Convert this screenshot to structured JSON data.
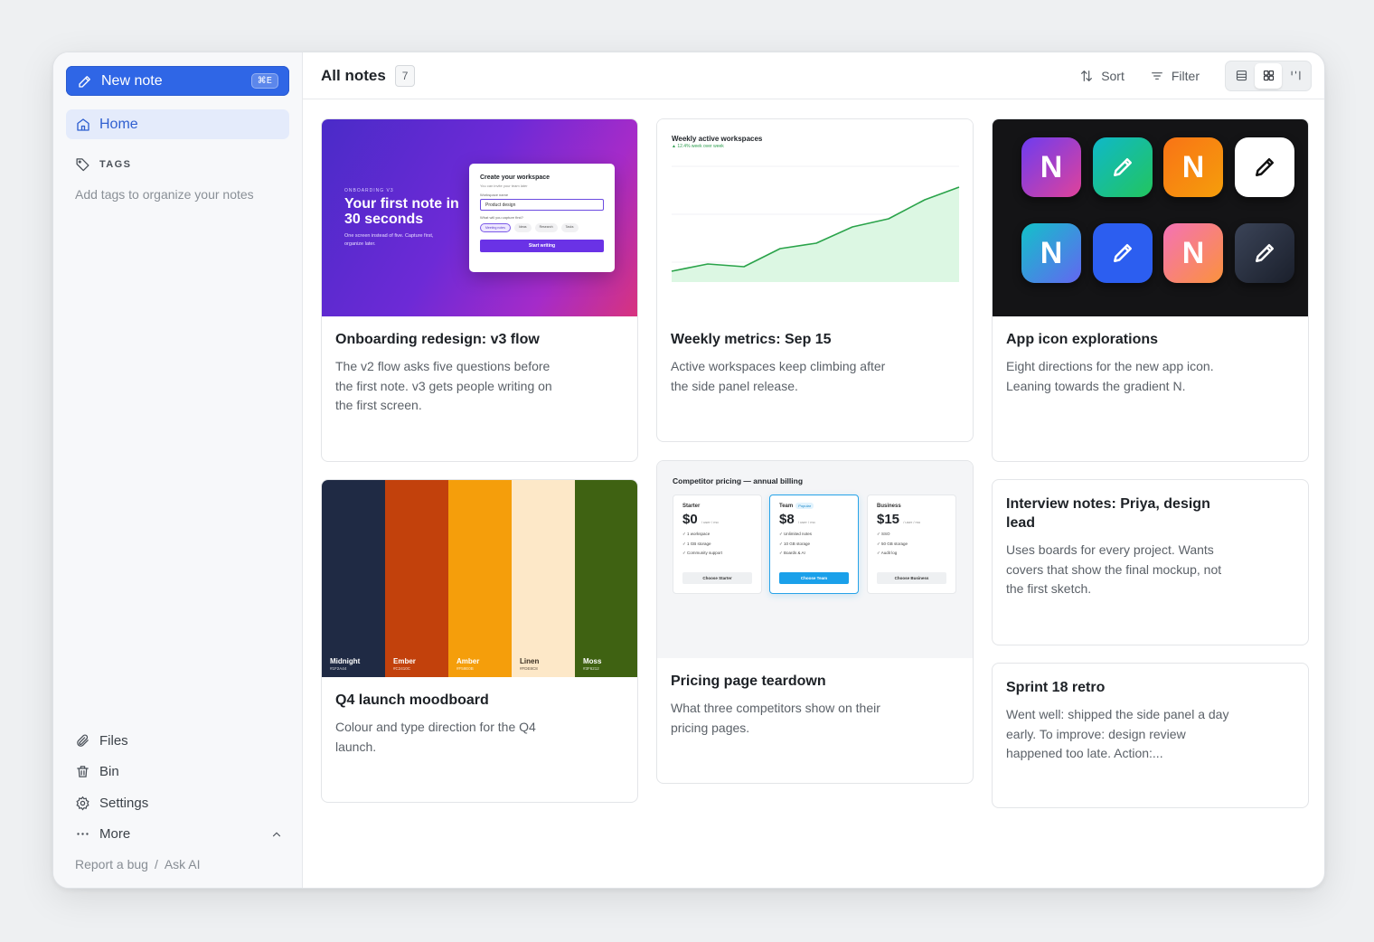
{
  "sidebar": {
    "new_note": {
      "label": "New note",
      "shortcut": "⌘E"
    },
    "home": "Home",
    "tags": {
      "heading": "TAGS",
      "hint": "Add tags to organize your notes"
    },
    "links": {
      "files": "Files",
      "bin": "Bin",
      "settings": "Settings",
      "more": "More"
    },
    "footer": {
      "report": "Report a bug",
      "sep": "/",
      "ask": "Ask AI"
    }
  },
  "topbar": {
    "title": "All notes",
    "count": "7",
    "sort": "Sort",
    "filter": "Filter"
  },
  "cards": {
    "onboarding": {
      "title": "Onboarding redesign: v3 flow",
      "body": "The v2 flow asks five questions before the first note. v3 gets people writing on the first screen.",
      "cover": {
        "kicker": "ONBOARDING V3",
        "headline": "Your first note in 30 seconds",
        "sub": "One screen instead of five. Capture first, organize later.",
        "panel_title": "Create your workspace",
        "panel_sub": "You can invite your team later",
        "field_label": "Workspace name",
        "field_value": "Product design",
        "question": "What will you capture first?",
        "chips": [
          "Meeting notes",
          "Ideas",
          "Research",
          "Tasks"
        ],
        "button": "Start writing"
      }
    },
    "metrics": {
      "title": "Weekly metrics: Sep 15",
      "body": "Active workspaces keep climbing after the side panel release.",
      "cover": {
        "chart_title": "Weekly active workspaces",
        "delta": "▲ 12.4% week over week"
      }
    },
    "icons": {
      "title": "App icon explorations",
      "body": "Eight directions for the new app icon. Leaning towards the gradient N.",
      "letter": "N"
    },
    "moodboard": {
      "title": "Q4 launch moodboard",
      "body": "Colour and type direction for the Q4 launch.",
      "swatches": [
        {
          "name": "Midnight",
          "hex": "#1F2A44",
          "color": "#1f2a44",
          "text": "#ffffff"
        },
        {
          "name": "Ember",
          "hex": "#C2410C",
          "color": "#c2410c",
          "text": "#ffffff"
        },
        {
          "name": "Amber",
          "hex": "#F59E0B",
          "color": "#f59e0b",
          "text": "#ffffff"
        },
        {
          "name": "Linen",
          "hex": "#FDE8C8",
          "color": "#fde8c8",
          "text": "#3a2f22"
        },
        {
          "name": "Moss",
          "hex": "#3F6212",
          "color": "#3f6212",
          "text": "#ffffff"
        }
      ]
    },
    "pricing": {
      "title": "Pricing page teardown",
      "body": "What three competitors show on their pricing pages.",
      "cover": {
        "heading": "Competitor pricing — annual billing",
        "tiers": [
          {
            "name": "Starter",
            "badge": "",
            "price": "$0",
            "unit": "/ user / mo",
            "features": [
              "✓ 1 workspace",
              "✓ 1 GB storage",
              "✓ Community support"
            ],
            "cta": "Choose Starter"
          },
          {
            "name": "Team",
            "badge": "Popular",
            "price": "$8",
            "unit": "/ user / mo",
            "features": [
              "✓ Unlimited notes",
              "✓ 10 GB storage",
              "✓ Boards & AI"
            ],
            "cta": "Choose Team"
          },
          {
            "name": "Business",
            "badge": "",
            "price": "$15",
            "unit": "/ user / mo",
            "features": [
              "✓ SSO",
              "✓ 50 GB storage",
              "✓ Audit log"
            ],
            "cta": "Choose Business"
          }
        ]
      }
    },
    "interview": {
      "title": "Interview notes: Priya, design lead",
      "body": "Uses boards for every project. Wants covers that show the final mockup, not the first sketch."
    },
    "retro": {
      "title": "Sprint 18 retro",
      "body": "Went well: shipped the side panel a day early. To improve: design review happened too late. Action:..."
    }
  },
  "colors": {
    "accent": "#2f66e6",
    "chart_line": "#2aa34a",
    "chart_fill": "#dcf7e3"
  }
}
